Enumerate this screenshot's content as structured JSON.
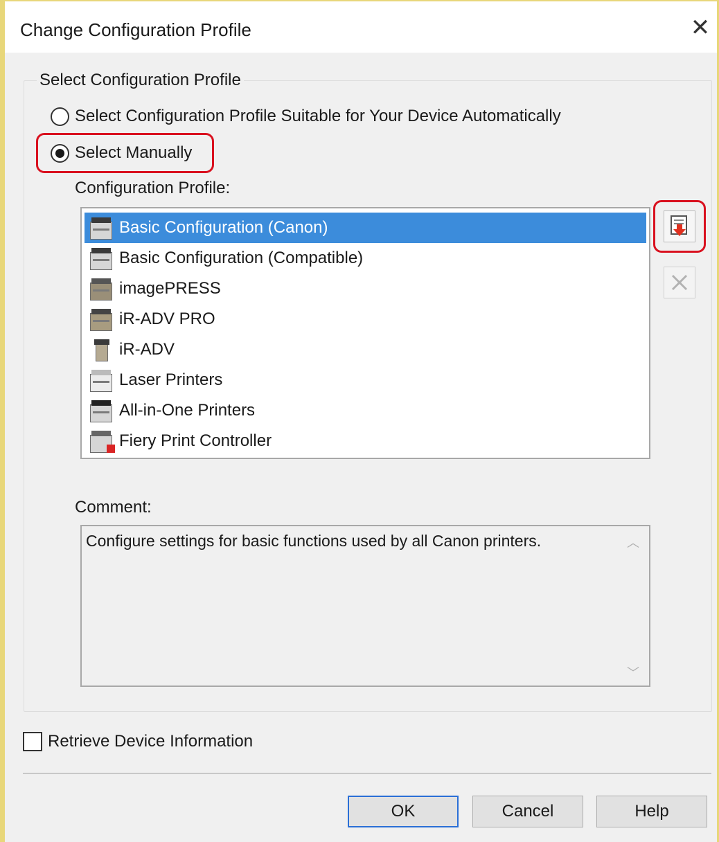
{
  "window": {
    "title": "Change Configuration Profile",
    "close_glyph": "✕"
  },
  "group": {
    "legend": "Select Configuration Profile",
    "radio_auto": {
      "label": "Select Configuration Profile Suitable for Your Device Automatically",
      "checked": false
    },
    "radio_manual": {
      "label": "Select Manually",
      "checked": true
    },
    "profile_label": "Configuration Profile:",
    "profiles": [
      {
        "label": "Basic Configuration (Canon)",
        "icon": "printer-basic-icon",
        "selected": true
      },
      {
        "label": "Basic Configuration (Compatible)",
        "icon": "printer-basic-icon",
        "selected": false
      },
      {
        "label": "imagePRESS",
        "icon": "production-printer-icon",
        "selected": false
      },
      {
        "label": "iR-ADV PRO",
        "icon": "production-printer-icon",
        "selected": false
      },
      {
        "label": "iR-ADV",
        "icon": "multifunction-printer-icon",
        "selected": false
      },
      {
        "label": "Laser Printers",
        "icon": "laser-printer-icon",
        "selected": false
      },
      {
        "label": "All-in-One Printers",
        "icon": "all-in-one-printer-icon",
        "selected": false
      },
      {
        "label": "Fiery Print Controller",
        "icon": "fiery-controller-icon",
        "selected": false
      }
    ],
    "comment_label": "Comment:",
    "comment_text": "Configure settings for basic functions used by all Canon printers."
  },
  "retrieve_checkbox": {
    "label": "Retrieve Device Information",
    "checked": false
  },
  "buttons": {
    "ok": "OK",
    "cancel": "Cancel",
    "help": "Help"
  },
  "colors": {
    "selection": "#3c8cdb",
    "highlight_annotation": "#d9111f",
    "import_arrow": "#e0301e"
  }
}
